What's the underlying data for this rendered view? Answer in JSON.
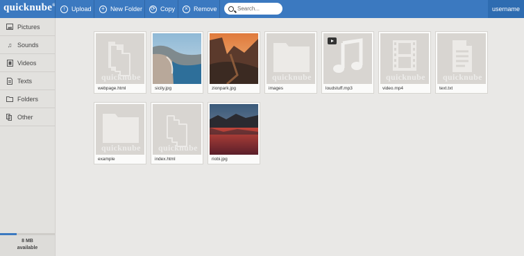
{
  "app": {
    "logo": "quicknube",
    "logo_mark": "®",
    "username": "username"
  },
  "toolbar": {
    "upload": "Upload",
    "new_folder": "New Folder",
    "copy": "Copy",
    "remove": "Remove",
    "search_placeholder": "Search..."
  },
  "sidebar": {
    "items": [
      {
        "label": "Pictures",
        "icon": "picture-icon"
      },
      {
        "label": "Sounds",
        "icon": "music-note-icon"
      },
      {
        "label": "Videos",
        "icon": "video-icon"
      },
      {
        "label": "Texts",
        "icon": "document-icon"
      },
      {
        "label": "Folders",
        "icon": "folder-icon"
      },
      {
        "label": "Other",
        "icon": "files-icon"
      }
    ],
    "storage": {
      "line1": "8 MB",
      "line2": "available",
      "used_fraction": 0.3
    }
  },
  "files": [
    {
      "name": "webpage.html",
      "type": "generic"
    },
    {
      "name": "sicily.jpg",
      "type": "image"
    },
    {
      "name": "zionpark.jpg",
      "type": "image"
    },
    {
      "name": "images",
      "type": "folder"
    },
    {
      "name": "loudstuff.mp3",
      "type": "audio"
    },
    {
      "name": "video.mp4",
      "type": "video"
    },
    {
      "name": "text.txt",
      "type": "text"
    },
    {
      "name": "example",
      "type": "folder"
    },
    {
      "name": "index.html",
      "type": "generic"
    },
    {
      "name": "riobi.jpg",
      "type": "image"
    }
  ],
  "watermark": "quicknube"
}
